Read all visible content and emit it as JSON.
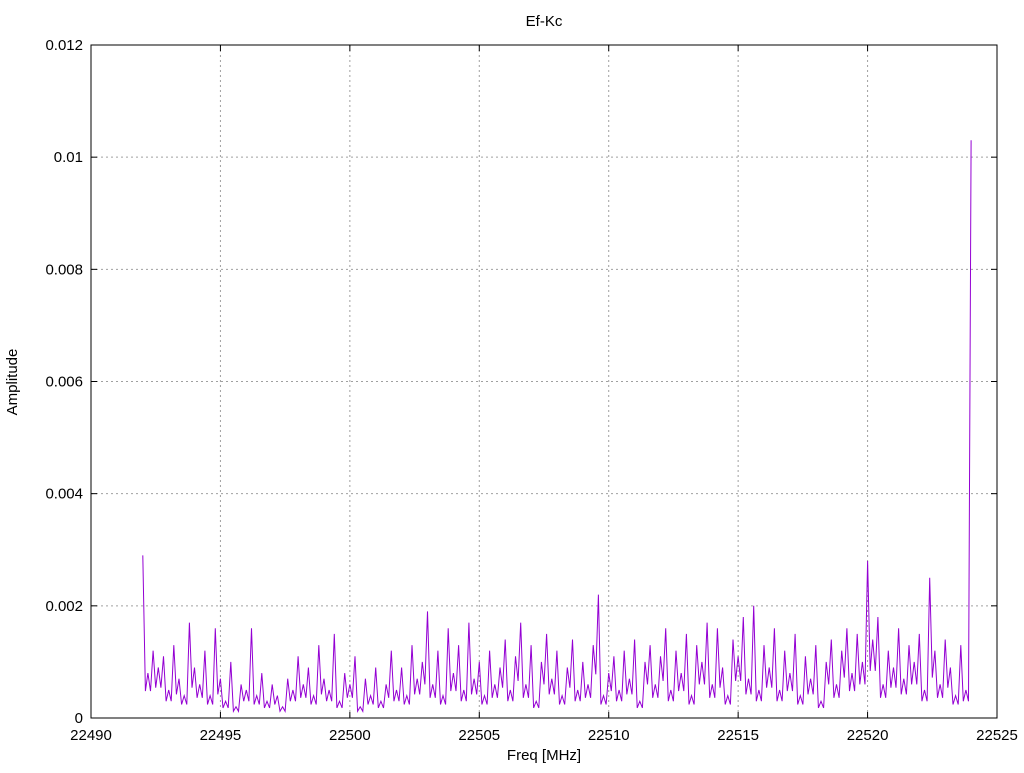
{
  "chart_data": {
    "type": "line",
    "title": "Ef-Kc",
    "xlabel": "Freq [MHz]",
    "ylabel": "Amplitude",
    "xlim": [
      22490,
      22525
    ],
    "ylim": [
      0,
      0.012
    ],
    "xticks": [
      22490,
      22495,
      22500,
      22505,
      22510,
      22515,
      22520,
      22525
    ],
    "yticks": [
      0,
      0.002,
      0.004,
      0.006,
      0.008,
      0.01,
      0.012
    ],
    "ytick_labels": [
      "0",
      "0.002",
      "0.004",
      "0.006",
      "0.008",
      "0.01",
      "0.012"
    ],
    "grid": true,
    "legend": "none",
    "series": [
      {
        "name": "Ef-Kc",
        "color": "#9400d3",
        "x_start": 22492,
        "x_step": 0.2,
        "values": [
          0.0029,
          0.0008,
          0.0012,
          0.0009,
          0.0011,
          0.0005,
          0.0013,
          0.0007,
          0.0004,
          0.0017,
          0.0009,
          0.0006,
          0.0012,
          0.0004,
          0.0016,
          0.0007,
          0.0003,
          0.001,
          0.0002,
          0.0006,
          0.0005,
          0.0016,
          0.0004,
          0.0008,
          0.0003,
          0.0006,
          0.0004,
          0.0002,
          0.0007,
          0.0005,
          0.0011,
          0.0006,
          0.0009,
          0.0004,
          0.0013,
          0.0007,
          0.0005,
          0.0015,
          0.0003,
          0.0008,
          0.0006,
          0.0011,
          0.0002,
          0.0007,
          0.0004,
          0.0009,
          0.0003,
          0.0006,
          0.0012,
          0.0005,
          0.0009,
          0.0004,
          0.0013,
          0.0007,
          0.001,
          0.0019,
          0.0006,
          0.0012,
          0.0004,
          0.0016,
          0.0008,
          0.0013,
          0.0005,
          0.0017,
          0.0007,
          0.001,
          0.0004,
          0.0012,
          0.0006,
          0.0009,
          0.0014,
          0.0005,
          0.0011,
          0.0017,
          0.0006,
          0.0013,
          0.0003,
          0.001,
          0.0015,
          0.0007,
          0.0012,
          0.0004,
          0.0009,
          0.0014,
          0.0005,
          0.001,
          0.0006,
          0.0013,
          0.0022,
          0.0004,
          0.0008,
          0.0011,
          0.0005,
          0.0012,
          0.0007,
          0.0014,
          0.0003,
          0.001,
          0.0013,
          0.0006,
          0.0011,
          0.0016,
          0.0005,
          0.0012,
          0.0008,
          0.0015,
          0.0004,
          0.0013,
          0.001,
          0.0017,
          0.0006,
          0.0016,
          0.0009,
          0.0004,
          0.0014,
          0.0011,
          0.0018,
          0.0007,
          0.002,
          0.0005,
          0.0013,
          0.0009,
          0.0016,
          0.0005,
          0.0012,
          0.0008,
          0.0015,
          0.0004,
          0.0011,
          0.0007,
          0.0013,
          0.0003,
          0.001,
          0.0014,
          0.0006,
          0.0012,
          0.0016,
          0.0008,
          0.0015,
          0.001,
          0.0028,
          0.0014,
          0.0018,
          0.0006,
          0.0012,
          0.0009,
          0.0016,
          0.0007,
          0.0013,
          0.001,
          0.0015,
          0.0005,
          0.0025,
          0.0012,
          0.0006,
          0.0014,
          0.0009,
          0.0004,
          0.0013,
          0.0005,
          0.0103
        ]
      }
    ]
  }
}
